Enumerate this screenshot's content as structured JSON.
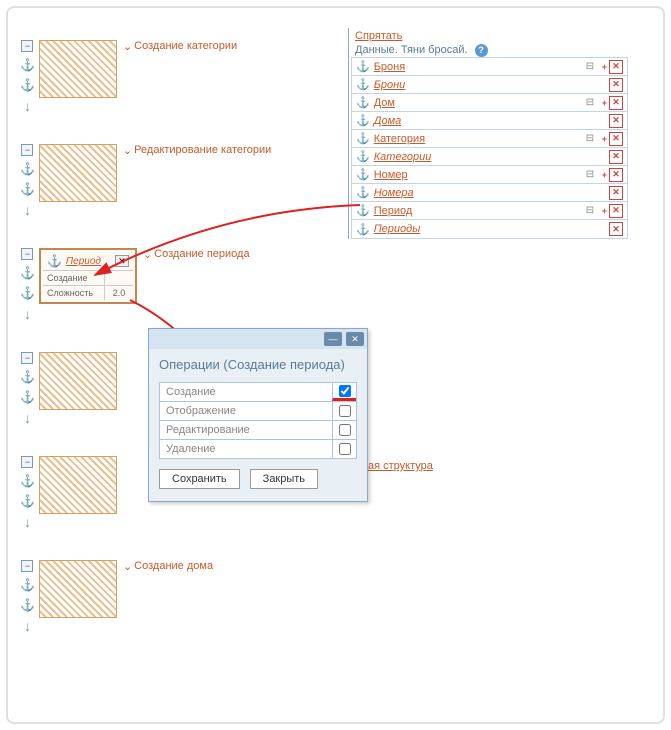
{
  "left_blocks": [
    {
      "label": "Создание категории"
    },
    {
      "label": "Редактирование категории"
    },
    {
      "label": "Создание периода"
    },
    {
      "label": ""
    },
    {
      "label": ""
    },
    {
      "label": "Создание дома"
    }
  ],
  "period_detail": {
    "link": "Период",
    "row1_label": "Создание",
    "row2_label": "Сложность",
    "row2_val": "2.0"
  },
  "right": {
    "hide": "Спрятать",
    "header": "Данные. Тяни бросай.",
    "items": [
      {
        "text": "Броня",
        "italic": false
      },
      {
        "text": "Брони",
        "italic": true
      },
      {
        "text": "Дом",
        "italic": false
      },
      {
        "text": "Дома",
        "italic": true
      },
      {
        "text": "Категория",
        "italic": false
      },
      {
        "text": "Категории",
        "italic": true
      },
      {
        "text": "Номер",
        "italic": false
      },
      {
        "text": "Номера",
        "italic": true
      },
      {
        "text": "Период",
        "italic": false
      },
      {
        "text": "Периоды",
        "italic": true
      }
    ]
  },
  "struct_link": "ая структура",
  "dialog": {
    "title": "Операции (Создание периода)",
    "ops": [
      {
        "label": "Создание",
        "checked": true
      },
      {
        "label": "Отображение",
        "checked": false
      },
      {
        "label": "Редактирование",
        "checked": false
      },
      {
        "label": "Удаление",
        "checked": false
      }
    ],
    "save": "Сохранить",
    "close": "Закрыть"
  }
}
